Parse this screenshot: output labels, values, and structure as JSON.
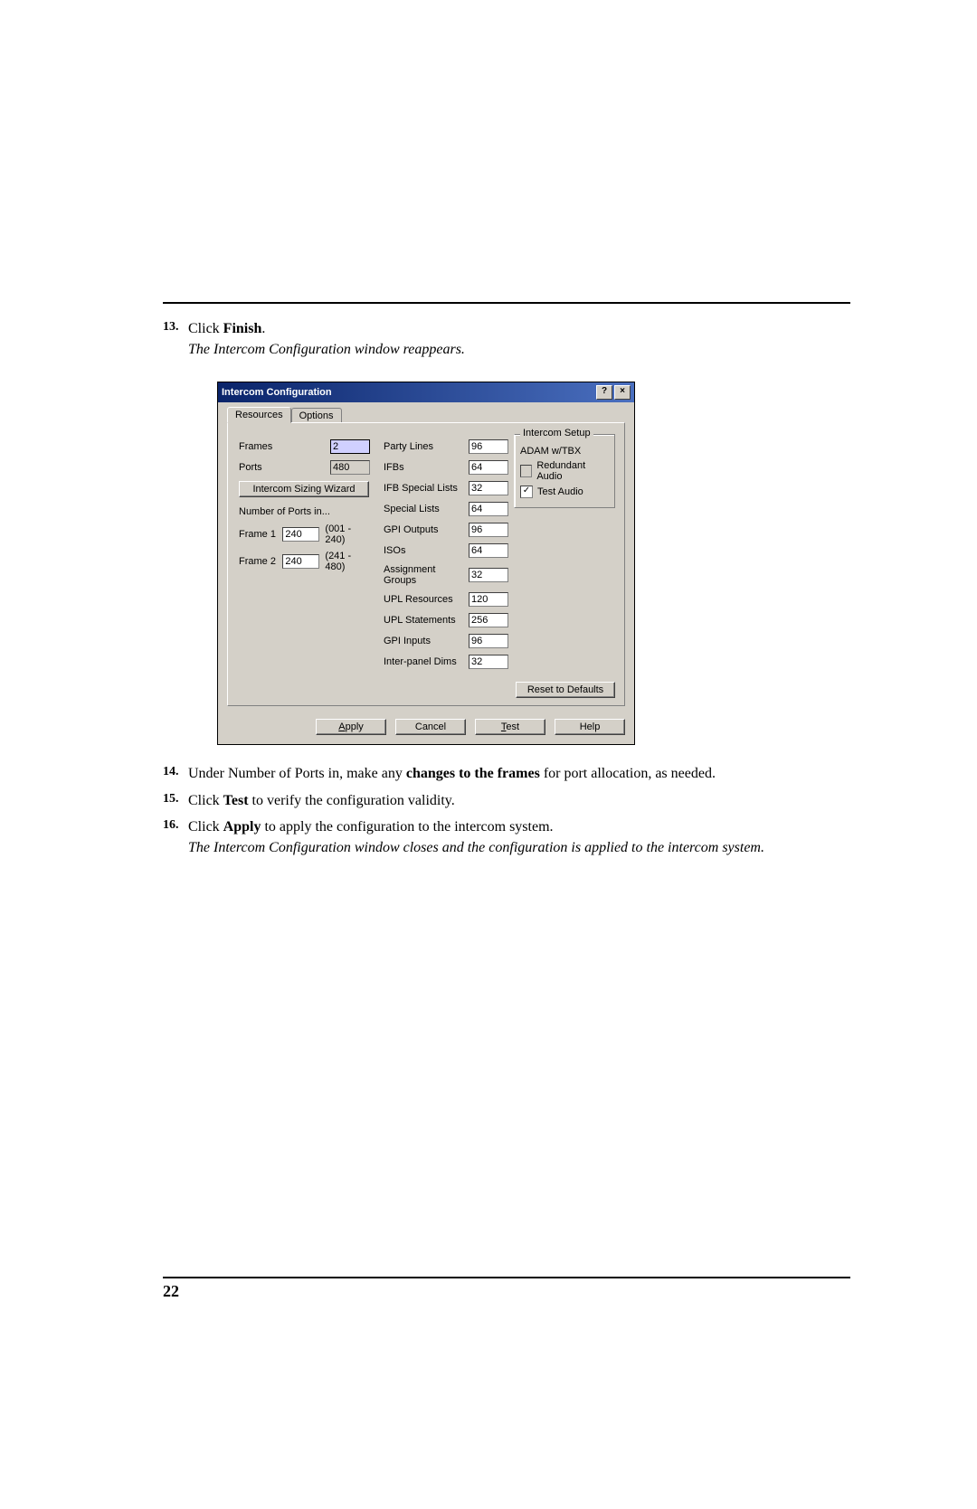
{
  "steps": {
    "s13_num": "13.",
    "s13_click": "Click ",
    "s13_finish": "Finish",
    "s13_dot": ".",
    "s13_result": "The Intercom Configuration window reappears.",
    "s14_num": "14.",
    "s14_a": "Under Number of Ports in, make any ",
    "s14_b": "changes to the frames",
    "s14_c": " for port allocation, as needed.",
    "s15_num": "15.",
    "s15_a": "Click ",
    "s15_b": "Test",
    "s15_c": " to verify the configuration validity.",
    "s16_num": "16.",
    "s16_a": "Click ",
    "s16_b": "Apply",
    "s16_c": " to apply the configuration to the intercom system.",
    "s16_result": "The Intercom Configuration window closes and the configuration is applied to the intercom system."
  },
  "dialog": {
    "title": "Intercom Configuration",
    "help_btn": "?",
    "close_btn": "×",
    "tab_resources": "Resources",
    "tab_options": "Options",
    "frames_label": "Frames",
    "frames_value": "2",
    "ports_label": "Ports",
    "ports_value": "480",
    "sizing_wizard_btn": "Intercom Sizing Wizard",
    "num_ports_header": "Number of Ports in...",
    "frame1_label": "Frame 1",
    "frame1_value": "240",
    "frame1_range": "(001 - 240)",
    "frame2_label": "Frame 2",
    "frame2_value": "240",
    "frame2_range": "(241 - 480)",
    "party_lines_label": "Party Lines",
    "party_lines_value": "96",
    "ifbs_label": "IFBs",
    "ifbs_value": "64",
    "ifb_sl_label": "IFB Special Lists",
    "ifb_sl_value": "32",
    "sl_label": "Special Lists",
    "sl_value": "64",
    "gpi_out_label": "GPI Outputs",
    "gpi_out_value": "96",
    "isos_label": "ISOs",
    "isos_value": "64",
    "ag_label": "Assignment Groups",
    "ag_value": "32",
    "uplr_label": "UPL Resources",
    "uplr_value": "120",
    "upls_label": "UPL Statements",
    "upls_value": "256",
    "gpi_in_label": "GPI Inputs",
    "gpi_in_value": "96",
    "ipd_label": "Inter-panel Dims",
    "ipd_value": "32",
    "setup_legend": "Intercom Setup",
    "adam_label": "ADAM w/TBX",
    "redundant_label": "Redundant Audio",
    "testaudio_label": "Test Audio",
    "testaudio_check": "✓",
    "reset_btn": "Reset to Defaults",
    "apply_btn_u": "A",
    "apply_btn_rest": "pply",
    "cancel_btn": "Cancel",
    "test_btn_u": "T",
    "test_btn_rest": "est",
    "help_btn_label": "Help"
  },
  "page_number": "22"
}
